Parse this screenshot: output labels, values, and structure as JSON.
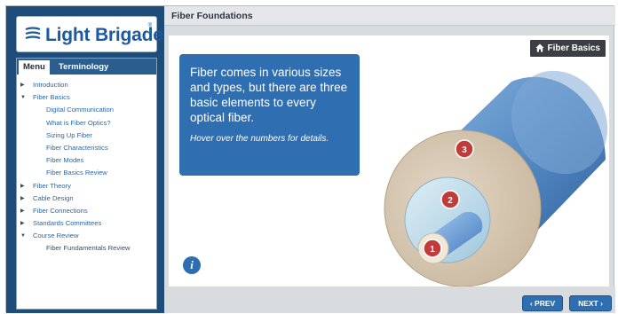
{
  "logo": {
    "text": "Light Brigade",
    "reg": "®"
  },
  "tabs": [
    {
      "label": "Menu",
      "active": true
    },
    {
      "label": "Terminology",
      "active": false
    }
  ],
  "menu": [
    {
      "label": "Introduction",
      "level": 0,
      "state": "collapsed"
    },
    {
      "label": "Fiber Basics",
      "level": 0,
      "state": "expanded"
    },
    {
      "label": "Digital Communication",
      "level": 1
    },
    {
      "label": "What is Fiber Optics?",
      "level": 1
    },
    {
      "label": "Sizing Up Fiber",
      "level": 1
    },
    {
      "label": "Fiber Characteristics",
      "level": 1
    },
    {
      "label": "Fiber Modes",
      "level": 1
    },
    {
      "label": "Fiber Basics Review",
      "level": 1
    },
    {
      "label": "Fiber Theory",
      "level": 0,
      "state": "collapsed"
    },
    {
      "label": "Cable Design",
      "level": 0,
      "state": "collapsed"
    },
    {
      "label": "Fiber Connections",
      "level": 0,
      "state": "collapsed"
    },
    {
      "label": "Standards Committees",
      "level": 0,
      "state": "collapsed"
    },
    {
      "label": "Course Review",
      "level": 0,
      "state": "expanded"
    },
    {
      "label": "Fiber Fundamentals Review",
      "level": 1
    }
  ],
  "header": {
    "title": "Fiber Foundations"
  },
  "section_badge": "Fiber Basics",
  "info_card": {
    "main": "Fiber comes in various sizes and types, but there are three basic elements to every optical fiber.",
    "hint": "Hover over the numbers for details."
  },
  "info_icon": "i",
  "diagram": {
    "labels": [
      "1",
      "2",
      "3"
    ]
  },
  "nav": {
    "prev": "‹ PREV",
    "next": "NEXT ›"
  },
  "colors": {
    "brand": "#1d5aa0",
    "accent": "#2f6eb0",
    "badge": "#3b3f44",
    "marker": "#c23b3b"
  }
}
